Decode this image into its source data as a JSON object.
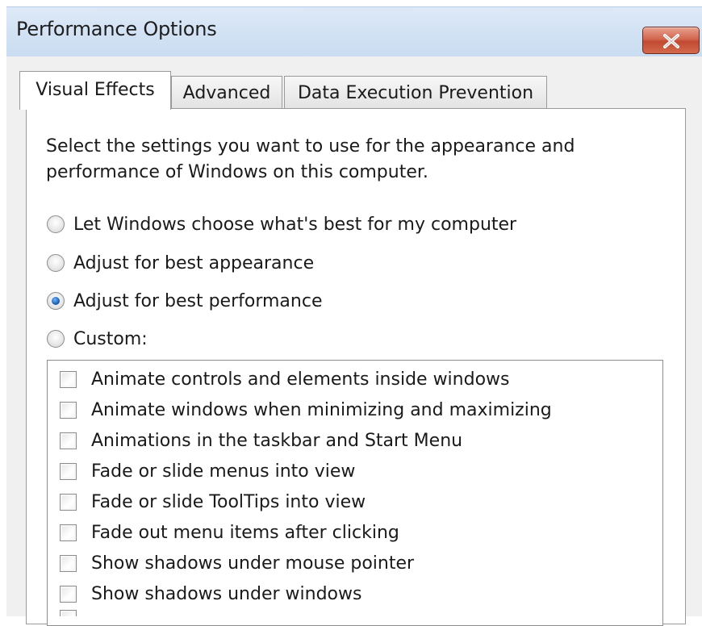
{
  "window": {
    "title": "Performance Options"
  },
  "tabs": [
    {
      "label": "Visual Effects",
      "active": true
    },
    {
      "label": "Advanced",
      "active": false
    },
    {
      "label": "Data Execution Prevention",
      "active": false
    }
  ],
  "description": "Select the settings you want to use for the appearance and performance of Windows on this computer.",
  "radio_options": [
    {
      "label": "Let Windows choose what's best for my computer",
      "checked": false
    },
    {
      "label": "Adjust for best appearance",
      "checked": false
    },
    {
      "label": "Adjust for best performance",
      "checked": true
    },
    {
      "label": "Custom:",
      "checked": false
    }
  ],
  "effects": [
    {
      "label": "Animate controls and elements inside windows",
      "checked": false
    },
    {
      "label": "Animate windows when minimizing and maximizing",
      "checked": false
    },
    {
      "label": "Animations in the taskbar and Start Menu",
      "checked": false
    },
    {
      "label": "Fade or slide menus into view",
      "checked": false
    },
    {
      "label": "Fade or slide ToolTips into view",
      "checked": false
    },
    {
      "label": "Fade out menu items after clicking",
      "checked": false
    },
    {
      "label": "Show shadows under mouse pointer",
      "checked": false
    },
    {
      "label": "Show shadows under windows",
      "checked": false
    }
  ],
  "icons": {
    "close": "close-icon"
  },
  "colors": {
    "close_button": "#c9553e",
    "titlebar": "#d3e3f5",
    "radio_selected": "#1d5fb3"
  }
}
